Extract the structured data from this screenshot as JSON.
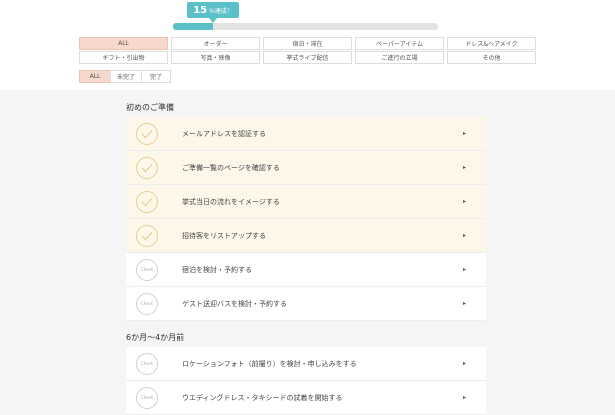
{
  "progress": {
    "percent_label": "15",
    "suffix": "%達成！",
    "fraction": 0.15
  },
  "categories": [
    {
      "label": "ALL",
      "active": true
    },
    {
      "label": "オーダー",
      "active": false
    },
    {
      "label": "宿泊・滞在",
      "active": false
    },
    {
      "label": "ペーパーアイテム",
      "active": false
    },
    {
      "label": "ドレス&ヘアメイク",
      "active": false
    },
    {
      "label": "ギフト・引出物",
      "active": false
    },
    {
      "label": "写真・映像",
      "active": false
    },
    {
      "label": "挙式ライブ配信",
      "active": false
    },
    {
      "label": "ご進行の立場",
      "active": false
    },
    {
      "label": "その他",
      "active": false
    }
  ],
  "status_tabs": [
    {
      "label": "ALL",
      "active": true
    },
    {
      "label": "未完了",
      "active": false
    },
    {
      "label": "完了",
      "active": false
    }
  ],
  "sections": [
    {
      "title": "初めのご準備",
      "tasks": [
        {
          "label": "メールアドレスを認証する",
          "done": true
        },
        {
          "label": "ご準備一覧のページを確認する",
          "done": true
        },
        {
          "label": "挙式当日の流れをイメージする",
          "done": true
        },
        {
          "label": "招待客をリストアップする",
          "done": true
        },
        {
          "label": "宿泊を検討・予約する",
          "done": false
        },
        {
          "label": "ゲスト送迎バスを検討・予約する",
          "done": false
        }
      ]
    },
    {
      "title": "6か月〜4か月前",
      "tasks": [
        {
          "label": "ロケーションフォト（前撮り）を検討・申し込みをする",
          "done": false
        },
        {
          "label": "ウエディングドレス・タキシードの試着を開始する",
          "done": false
        }
      ]
    }
  ],
  "check_label": "Check",
  "arrow_glyph": "▸",
  "colors": {
    "accent": "#5bc0c7",
    "active_tab": "#f7d8cc",
    "done_row": "#fdf7ea",
    "done_check": "#e9cc92"
  }
}
